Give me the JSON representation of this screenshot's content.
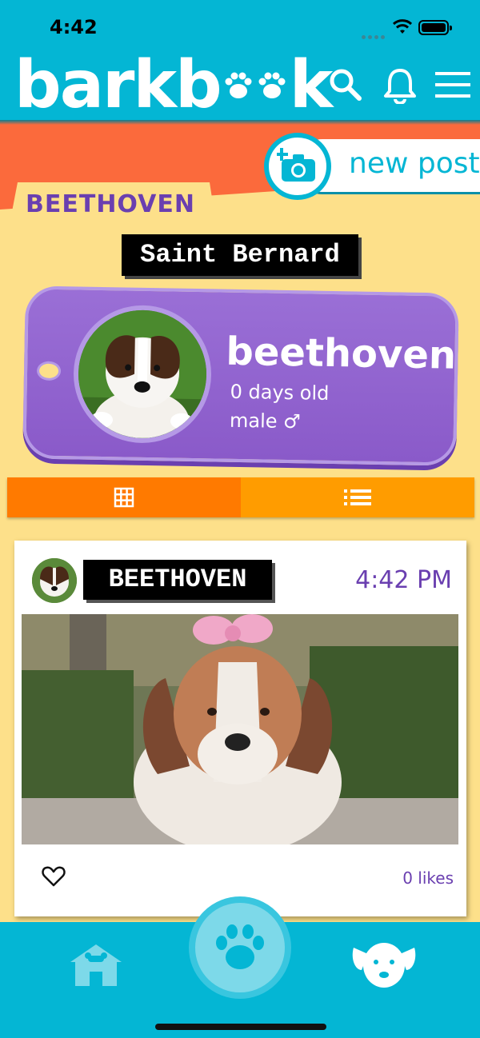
{
  "status_bar": {
    "time": "4:42"
  },
  "header": {
    "logo_text_start": "barkb",
    "logo_text_end": "k"
  },
  "new_post": {
    "label": "new post"
  },
  "profile": {
    "tab_name": "BEETHOVEN",
    "breed": "Saint Bernard",
    "name": "beethoven",
    "age": "0 days old",
    "gender": "male ♂"
  },
  "post": {
    "author": "BEETHOVEN",
    "time": "4:42 PM",
    "likes": "0 likes"
  },
  "colors": {
    "header": "#04b6d4",
    "banner": "#fb6a3c",
    "background": "#fde08a",
    "tag": "#8a5ac9",
    "accent_purple": "#6a3fb0",
    "grid_tab": "#ff7a00",
    "list_tab": "#ff9c00"
  },
  "icons": {
    "header": [
      "search-icon",
      "bell-icon",
      "menu-icon"
    ],
    "toggle": [
      "grid-icon",
      "list-icon"
    ],
    "bottom_nav": [
      "home-icon",
      "paw-icon",
      "dog-icon"
    ]
  }
}
